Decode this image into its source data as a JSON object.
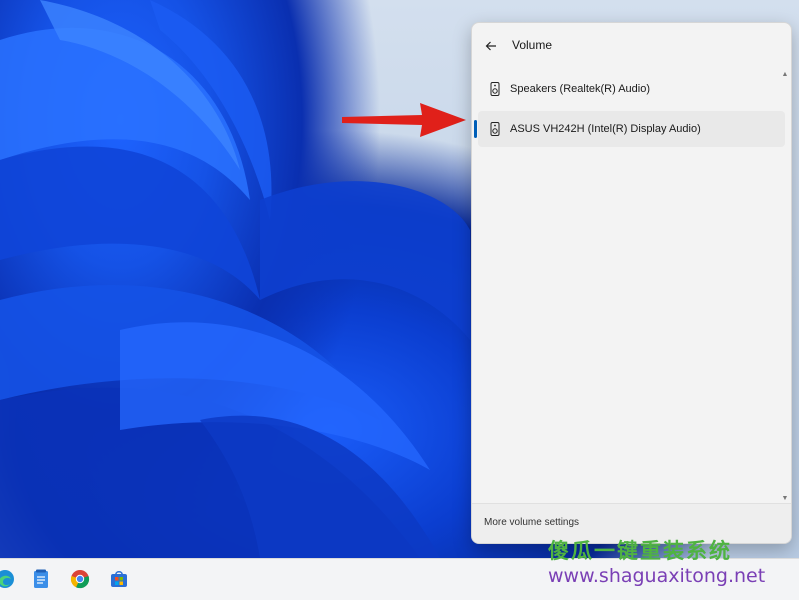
{
  "flyout": {
    "title": "Volume",
    "back_icon": "arrow-left-icon",
    "devices": [
      {
        "label": "Speakers (Realtek(R) Audio)",
        "icon": "speaker-icon",
        "selected": false
      },
      {
        "label": "ASUS VH242H (Intel(R) Display Audio)",
        "icon": "speaker-icon",
        "selected": true
      }
    ],
    "footer_link": "More volume settings"
  },
  "taskbar": {
    "icons": [
      "edge-icon",
      "notepad-icon",
      "chrome-icon",
      "store-icon"
    ]
  },
  "watermark": {
    "line1": "傻瓜一键重装系统",
    "line2": "www.shaguaxitong.net"
  },
  "colors": {
    "accent": "#005fb8",
    "arrow": "#e0201a",
    "watermark_green": "#4fb341",
    "watermark_purple": "#7a3fb5"
  }
}
